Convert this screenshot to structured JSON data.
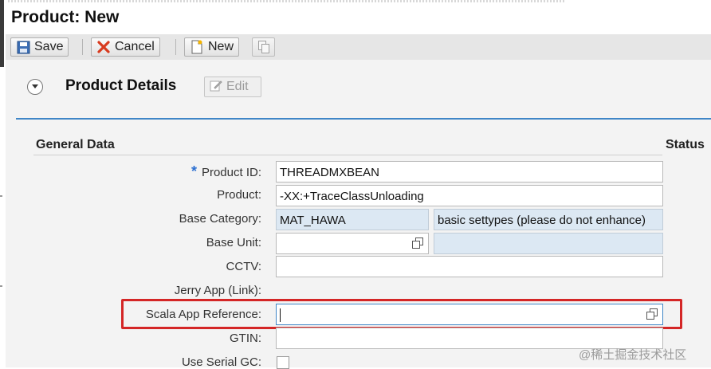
{
  "page": {
    "title": "Product: New"
  },
  "toolbar": {
    "save_label": "Save",
    "cancel_label": "Cancel",
    "new_label": "New"
  },
  "section": {
    "title": "Product Details",
    "edit_label": "Edit"
  },
  "group": {
    "title": "General Data",
    "status_title": "Status"
  },
  "form": {
    "product_id_label": "Product ID:",
    "product_id_value": "THREADMXBEAN",
    "product_label": "Product:",
    "product_value": "-XX:+TraceClassUnloading",
    "base_category_label": "Base Category:",
    "base_category_value": "MAT_HAWA",
    "base_category_desc": "basic settypes (please do not enhance)",
    "base_unit_label": "Base Unit:",
    "base_unit_value": "",
    "base_unit_desc": "",
    "cctv_label": "CCTV:",
    "cctv_value": "",
    "jerry_label": "Jerry App (Link):",
    "scala_label": "Scala App Reference:",
    "scala_value": "",
    "gtin_label": "GTIN:",
    "gtin_value": "",
    "serial_label": "Use Serial GC:"
  },
  "watermark": "@稀土掘金技术社区",
  "colors": {
    "accent": "#3f86c7",
    "highlight": "#d42626",
    "required": "#2b6fd1",
    "readonly": "#dce8f3"
  }
}
